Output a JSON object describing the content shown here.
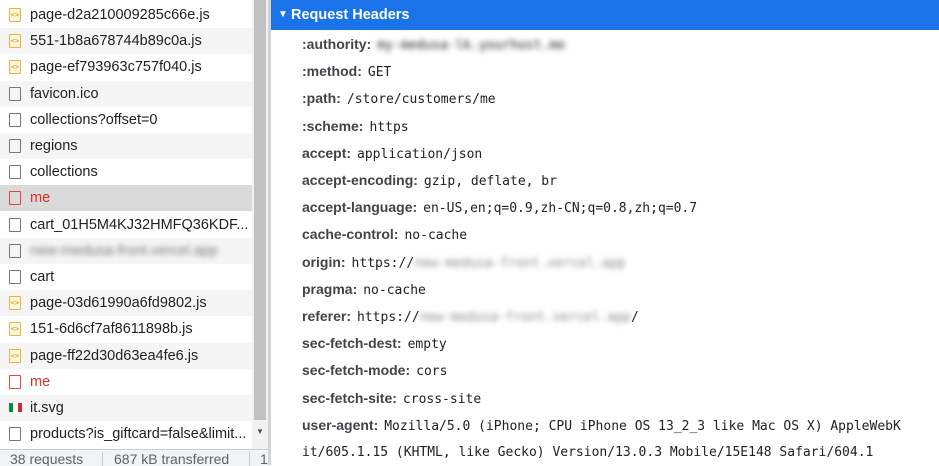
{
  "requests": [
    {
      "name": "page-d2a210009285c66e.js",
      "icon": "js-file-icon",
      "status": "ok"
    },
    {
      "name": "551-1b8a678744b89c0a.js",
      "icon": "js-file-icon",
      "status": "ok"
    },
    {
      "name": "page-ef793963c757f040.js",
      "icon": "js-file-icon",
      "status": "ok"
    },
    {
      "name": "favicon.ico",
      "icon": "document-icon",
      "status": "ok"
    },
    {
      "name": "collections?offset=0",
      "icon": "document-icon",
      "status": "ok"
    },
    {
      "name": "regions",
      "icon": "document-icon",
      "status": "ok"
    },
    {
      "name": "collections",
      "icon": "document-icon",
      "status": "ok"
    },
    {
      "name": "me",
      "icon": "document-icon",
      "status": "error",
      "selected": true
    },
    {
      "name": "cart_01H5M4KJ32HMFQ36KDF...",
      "icon": "document-icon",
      "status": "ok"
    },
    {
      "name": "new-medusa-front.vercel.app",
      "icon": "document-icon",
      "status": "ok",
      "blurred": true
    },
    {
      "name": "cart",
      "icon": "document-icon",
      "status": "ok"
    },
    {
      "name": "page-03d61990a6fd9802.js",
      "icon": "js-file-icon",
      "status": "ok"
    },
    {
      "name": "151-6d6cf7af8611898b.js",
      "icon": "js-file-icon",
      "status": "ok"
    },
    {
      "name": "page-ff22d30d63ea4fe6.js",
      "icon": "js-file-icon",
      "status": "ok"
    },
    {
      "name": "me",
      "icon": "document-icon",
      "status": "error"
    },
    {
      "name": "it.svg",
      "icon": "italy-flag-icon",
      "status": "ok"
    },
    {
      "name": "products?is_giftcard=false&limit...",
      "icon": "document-icon",
      "status": "ok"
    }
  ],
  "status_bar": {
    "requests": "38 requests",
    "transferred": "687 kB transferred",
    "more": "1"
  },
  "section": {
    "title": "Request Headers"
  },
  "headers": [
    {
      "key": ":authority:",
      "value": "my-medusa-lk.yourhost.me",
      "blurred": true
    },
    {
      "key": ":method:",
      "value": "GET"
    },
    {
      "key": ":path:",
      "value": "/store/customers/me"
    },
    {
      "key": ":scheme:",
      "value": "https"
    },
    {
      "key": "accept:",
      "value": "application/json"
    },
    {
      "key": "accept-encoding:",
      "value": "gzip, deflate, br"
    },
    {
      "key": "accept-language:",
      "value": "en-US,en;q=0.9,zh-CN;q=0.8,zh;q=0.7"
    },
    {
      "key": "cache-control:",
      "value": "no-cache"
    },
    {
      "key": "origin:",
      "value": "https://",
      "blurred_suffix": "new-medusa-front.vercel.app"
    },
    {
      "key": "pragma:",
      "value": "no-cache"
    },
    {
      "key": "referer:",
      "value": "https://",
      "blurred_suffix": "new-medusa-front.vercel.app",
      "suffix": "/"
    },
    {
      "key": "sec-fetch-dest:",
      "value": "empty"
    },
    {
      "key": "sec-fetch-mode:",
      "value": "cors"
    },
    {
      "key": "sec-fetch-site:",
      "value": "cross-site"
    },
    {
      "key": "user-agent:",
      "value": "Mozilla/5.0 (iPhone; CPU iPhone OS 13_2_3 like Mac OS X) AppleWebK"
    }
  ],
  "user_agent_continuation": "it/605.1.15 (KHTML, like Gecko) Version/13.0.3 Mobile/15E148 Safari/604.1",
  "colors": {
    "accent": "#1a73e8",
    "error": "#d93025",
    "selected_row": "#dadada",
    "alt_row": "#f5f5f5",
    "flag": [
      "#009246",
      "#ffffff",
      "#ce2b37"
    ]
  }
}
